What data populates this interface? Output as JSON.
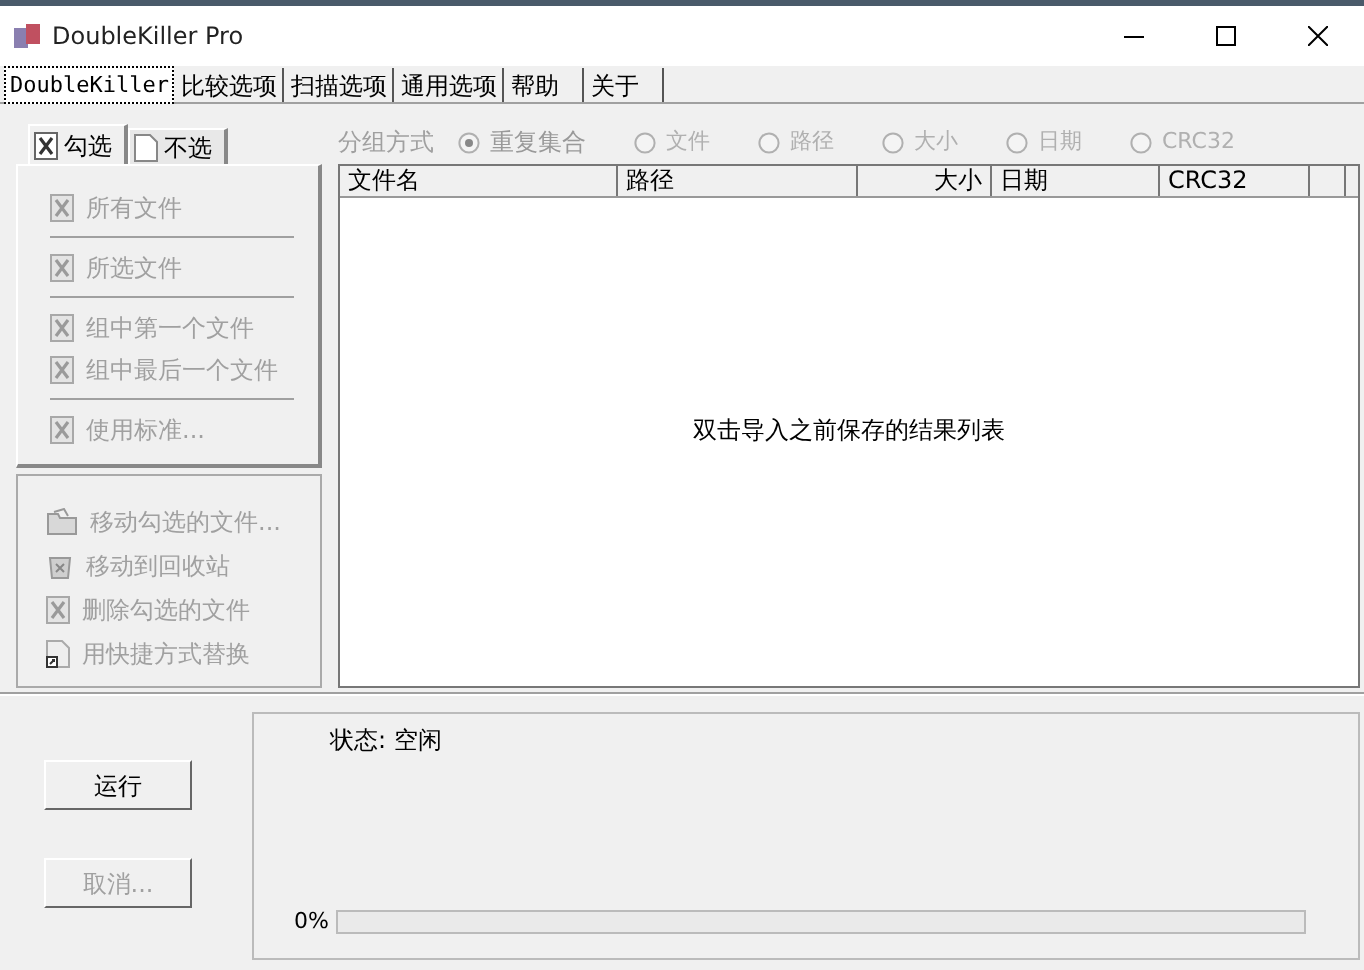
{
  "window": {
    "title": "DoubleKiller Pro"
  },
  "tabs": [
    {
      "label": "DoubleKiller",
      "selected": true
    },
    {
      "label": "比较选项",
      "selected": false
    },
    {
      "label": "扫描选项",
      "selected": false
    },
    {
      "label": "通用选项",
      "selected": false
    },
    {
      "label": "帮助",
      "selected": false
    },
    {
      "label": "关于",
      "selected": false
    }
  ],
  "check_tabs": [
    {
      "label": "勾选",
      "kind": "check",
      "selected": true
    },
    {
      "label": "不选",
      "kind": "blank",
      "selected": false
    }
  ],
  "check_menu": [
    {
      "items": [
        {
          "label": "所有文件",
          "disabled": true
        }
      ]
    },
    {
      "items": [
        {
          "label": "所选文件",
          "disabled": true
        }
      ]
    },
    {
      "items": [
        {
          "label": "组中第一个文件",
          "disabled": true
        },
        {
          "label": "组中最后一个文件",
          "disabled": true
        }
      ]
    },
    {
      "items": [
        {
          "label": "使用标准...",
          "disabled": true
        }
      ]
    }
  ],
  "actions": [
    {
      "label": "移动勾选的文件...",
      "kind": "folder",
      "disabled": true
    },
    {
      "label": "移动到回收站",
      "kind": "recycle",
      "disabled": true
    },
    {
      "label": "删除勾选的文件",
      "kind": "delete",
      "disabled": true
    },
    {
      "label": "用快捷方式替换",
      "kind": "shortcut",
      "disabled": true
    }
  ],
  "group_by": {
    "label": "分组方式",
    "options": [
      {
        "label": "重复集合",
        "selected": true
      },
      {
        "label": "文件",
        "selected": false
      },
      {
        "label": "路径",
        "selected": false
      },
      {
        "label": "大小",
        "selected": false
      },
      {
        "label": "日期",
        "selected": false
      },
      {
        "label": "CRC32",
        "selected": false
      }
    ]
  },
  "table": {
    "columns": [
      "文件名",
      "路径",
      "大小",
      "日期",
      "CRC32"
    ],
    "empty_message": "双击导入之前保存的结果列表"
  },
  "buttons": [
    {
      "label": "运行",
      "disabled": false
    },
    {
      "label": "取消...",
      "disabled": true
    }
  ],
  "status": {
    "text": "状态: 空闲",
    "progress_text": "0%",
    "level": 0
  }
}
